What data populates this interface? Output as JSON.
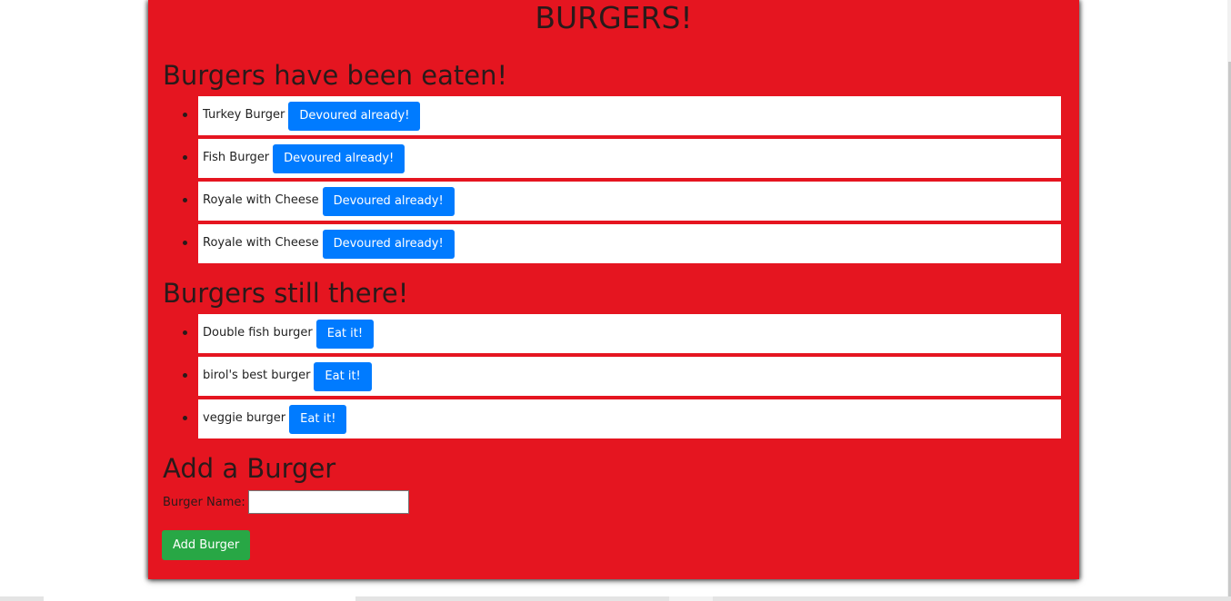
{
  "page": {
    "title": "BURGERS!"
  },
  "eaten": {
    "heading": "Burgers have been eaten!",
    "items": [
      {
        "name": "Turkey Burger",
        "button": "Devoured already!"
      },
      {
        "name": "Fish Burger",
        "button": "Devoured already!"
      },
      {
        "name": "Royale with Cheese",
        "button": "Devoured already!"
      },
      {
        "name": "Royale with Cheese",
        "button": "Devoured already!"
      }
    ]
  },
  "remaining": {
    "heading": "Burgers still there!",
    "items": [
      {
        "name": "Double fish burger",
        "button": "Eat it!"
      },
      {
        "name": "birol's best burger",
        "button": "Eat it!"
      },
      {
        "name": "veggie burger",
        "button": "Eat it!"
      }
    ]
  },
  "form": {
    "heading": "Add a Burger",
    "label": "Burger Name:",
    "input_value": "",
    "submit_label": "Add Burger"
  },
  "colors": {
    "panel_background": "#e51520",
    "primary_button": "#007bff",
    "success_button": "#28a745"
  }
}
